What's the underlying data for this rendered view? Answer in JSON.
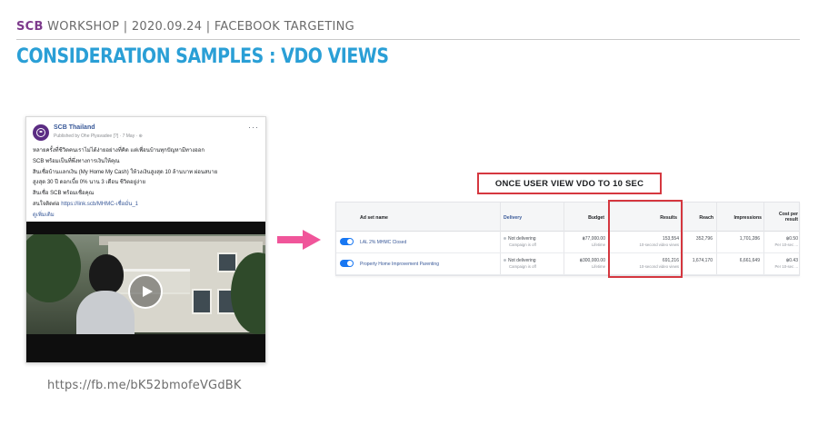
{
  "header": {
    "brand": "SCB",
    "rest": " WORKSHOP | 2020.09.24 | FACEBOOK TARGETING"
  },
  "title": "CONSIDERATION SAMPLES : VDO VIEWS",
  "post": {
    "page_name": "SCB Thailand",
    "meta": "Published by Ohe Plyavadee [?] · 7 May · ⊕",
    "lines": [
      "หลายครั้งที่ชีวิตคนเราไม่ได้ง่ายอย่างที่คิด แต่เพื่อนบ้านทุกปัญหามีทางออก",
      "SCB พร้อมเป็นที่พึ่งทางการเงินให้คุณ",
      "สินเชื่อบ้านแลกเงิน (My Home My Cash) ให้วงเงินสูงสุด 10 ล้านบาท ผ่อนสบาย",
      "สูงสุด 30 ปี ดอกเบี้ย 0% นาน 3 เดือน ชีวิตอยู่ง่าย",
      "สินเชื่อ SCB พร้อมเชื่อคุณ"
    ],
    "link_label": "สนใจติดต่อ",
    "link_url": "https://link.scb/MHMC-เชื่อมั่น_1",
    "see_more": "ดูเพิ่มเติม"
  },
  "url_caption": "https://fb.me/bK52bmofeVGdBK",
  "callout": "ONCE USER VIEW VDO TO 10 SEC",
  "table": {
    "headers": {
      "name": "Ad set name",
      "delivery": "Delivery",
      "budget": "Budget",
      "results": "Results",
      "reach": "Reach",
      "impressions": "Impressions",
      "cost": "Cost per result"
    },
    "rows": [
      {
        "name": "LAL 2% MHMC Closed",
        "delivery": "Not delivering",
        "delivery_sub": "Campaign is off",
        "budget": "฿77,000.00",
        "budget_sub": "Lifetime",
        "results": "153,554",
        "results_sub": "10-second video views",
        "reach": "352,796",
        "impressions": "1,701,286",
        "cost": "฿0.50",
        "cost_sub": "Per 10-sec ..."
      },
      {
        "name": "Property Home Improvement Parenting",
        "delivery": "Not delivering",
        "delivery_sub": "Campaign is off",
        "budget": "฿300,000.00",
        "budget_sub": "Lifetime",
        "results": "691,216",
        "results_sub": "10-second video views",
        "reach": "1,674,170",
        "impressions": "6,661,649",
        "cost": "฿0.43",
        "cost_sub": "Per 10-sec ..."
      }
    ]
  },
  "colors": {
    "brand_purple": "#7d3a8c",
    "title_blue": "#2a9fd6",
    "arrow_pink": "#f0559a",
    "highlight_red": "#d5373f",
    "fb_blue": "#1877f2"
  }
}
